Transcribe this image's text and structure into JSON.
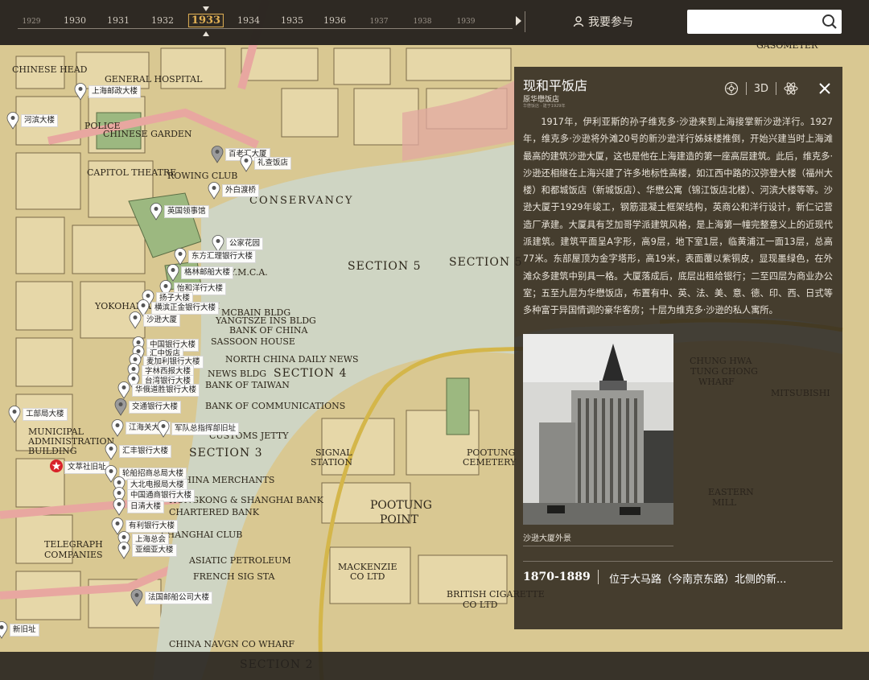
{
  "timeline": {
    "years": [
      {
        "label": "1929",
        "size": "sm"
      },
      {
        "label": "1930",
        "size": "md"
      },
      {
        "label": "1931",
        "size": "md"
      },
      {
        "label": "1932",
        "size": "md"
      },
      {
        "label": "1933",
        "size": "active"
      },
      {
        "label": "1934",
        "size": "md"
      },
      {
        "label": "1935",
        "size": "md"
      },
      {
        "label": "1936",
        "size": "md"
      },
      {
        "label": "1937",
        "size": "sm"
      },
      {
        "label": "1938",
        "size": "sm"
      },
      {
        "label": "1939",
        "size": "sm"
      }
    ],
    "selected": "1933",
    "play_icon": "play-icon"
  },
  "header": {
    "participate_label": "我要参与",
    "participate_icon": "user-icon",
    "search_placeholder": "",
    "search_icon": "search-icon"
  },
  "map": {
    "labels": [
      "CHINESE HEAD",
      "GENERAL HOSPITAL",
      "POLICE",
      "CHINESE GARDEN",
      "CAPITOL THEATRE",
      "ROWING CLUB",
      "CONSERVANCY",
      "SECTION 5",
      "SECTION 4",
      "SECTION 3",
      "SECTION 2",
      "YOKOHAMA SPECIE BANK",
      "BANK OF CHINA",
      "SASSOON HOUSE",
      "NEWS BLDG",
      "BANK OF TAIWAN",
      "BANK OF COMMUNICATIONS",
      "CUSTOMS JETTY",
      "CHINA MERCHANTS",
      "POOTUNG POINT",
      "MACKENZIE CO LTD",
      "BRITISH CIGARETTE CO LTD",
      "FRENCH SIG STA",
      "CHUNG HWA TUNG CHONG WHARF",
      "MITSUBISHI",
      "EASTERN MILL",
      "GASOMETER",
      "MUNICIPAL ADMINISTRATION BUILDING",
      "TELEGRAPH COMPANIES",
      "CHINA NAVGN CO WHARF",
      "HONGKONG & SHANGHAI BANK",
      "CHARTERED BANK",
      "ASIATIC PETROLEUM",
      "SHANGHAI CLUB",
      "NAVY Y.M.C.A.",
      "YANGTSZE INS BLDG",
      "MCBAIN BLDG",
      "NORTH CHINA DAILY NEWS",
      "POOTUNG CEMETERY",
      "SIGNAL STATION"
    ],
    "pins": [
      {
        "label": "上海邮政大楼",
        "color": "#ffffff",
        "type": "pin"
      },
      {
        "label": "河滨大楼",
        "color": "#ffffff",
        "type": "pin"
      },
      {
        "label": "百老汇大厦",
        "color": "#9b9b9b",
        "type": "pin"
      },
      {
        "label": "礼查饭店",
        "color": "#ffffff",
        "type": "pin"
      },
      {
        "label": "外白渡桥",
        "color": "#ffffff",
        "type": "pin"
      },
      {
        "label": "英国领事馆",
        "color": "#ffffff",
        "type": "pin"
      },
      {
        "label": "公家花园",
        "color": "#ffffff",
        "type": "pin"
      },
      {
        "label": "东方汇理银行大楼",
        "color": "#ffffff",
        "type": "pin"
      },
      {
        "label": "格林邮船大楼",
        "color": "#ffffff",
        "type": "pin"
      },
      {
        "label": "怡和洋行大楼",
        "color": "#ffffff",
        "type": "pin"
      },
      {
        "label": "扬子大楼",
        "color": "#ffffff",
        "type": "pin"
      },
      {
        "label": "横滨正金银行大楼",
        "color": "#ffffff",
        "type": "pin"
      },
      {
        "label": "沙逊大厦",
        "color": "#ffffff",
        "type": "pin"
      },
      {
        "label": "中国银行大楼",
        "color": "#ffffff",
        "type": "pin"
      },
      {
        "label": "汇中饭店",
        "color": "#ffffff",
        "type": "pin"
      },
      {
        "label": "麦加利银行大楼",
        "color": "#ffffff",
        "type": "pin"
      },
      {
        "label": "字林西报大楼",
        "color": "#ffffff",
        "type": "pin"
      },
      {
        "label": "台湾银行大楼",
        "color": "#ffffff",
        "type": "pin"
      },
      {
        "label": "华俄道胜银行大楼",
        "color": "#ffffff",
        "type": "pin"
      },
      {
        "label": "交通银行大楼",
        "color": "#9b9b9b",
        "type": "pin"
      },
      {
        "label": "工部局大楼",
        "color": "#ffffff",
        "type": "pin"
      },
      {
        "label": "江海关大楼",
        "color": "#ffffff",
        "type": "pin"
      },
      {
        "label": "军队总指挥部旧址",
        "color": "#ffffff",
        "type": "pin"
      },
      {
        "label": "汇丰银行大楼",
        "color": "#ffffff",
        "type": "pin"
      },
      {
        "label": "文萃社旧址",
        "color": "#d8222a",
        "type": "star"
      },
      {
        "label": "轮船招商总局大楼",
        "color": "#ffffff",
        "type": "pin"
      },
      {
        "label": "大北电报局大楼",
        "color": "#ffffff",
        "type": "pin"
      },
      {
        "label": "中国通商银行大楼",
        "color": "#ffffff",
        "type": "pin"
      },
      {
        "label": "日清大楼",
        "color": "#ffffff",
        "type": "pin"
      },
      {
        "label": "有利银行大楼",
        "color": "#ffffff",
        "type": "pin"
      },
      {
        "label": "上海总会",
        "color": "#ffffff",
        "type": "pin"
      },
      {
        "label": "亚细亚大楼",
        "color": "#ffffff",
        "type": "pin"
      },
      {
        "label": "法国邮船公司大楼",
        "color": "#9b9b9b",
        "type": "pin"
      },
      {
        "label": "新旧址",
        "color": "#ffffff",
        "type": "pin"
      }
    ]
  },
  "panel": {
    "title": "现和平饭店",
    "subtitle": "原华懋饭店",
    "subtitle_small": "华懋饭店 · 建于1929年",
    "tools": [
      "panorama-icon",
      "3D",
      "atom-icon"
    ],
    "close_icon": "close-icon",
    "body": "1917年，伊利亚斯的孙子维克多·沙逊来到上海接掌新沙逊洋行。1927年，维克多·沙逊将外滩20号的新沙逊洋行姊妹楼推倒，开始兴建当时上海滩最高的建筑沙逊大厦，这也是他在上海建造的第一座高层建筑。此后，维克多·沙逊还相继在上海兴建了许多地标性高楼，如江西中路的汉弥登大楼（福州大楼）和都城饭店（新城饭店）、华懋公寓（锦江饭店北楼）、河滨大楼等等。沙逊大厦于1929年竣工，钢筋混凝土框架结构，英商公和洋行设计，新仁记营造厂承建。大厦具有芝加哥学派建筑风格，是上海第一幢完整意义上的近现代派建筑。建筑平面呈A字形，高9层，地下室1层，临黄浦江一面13层，总高77米。东部屋顶为金字塔形，高19米，表面覆以紫铜皮，显现墨绿色，在外滩众多建筑中别具一格。大厦落成后，底层出租给银行；二至四层为商业办公室；五至九层为华懋饭店，布置有中、英、法、美、意、德、印、西、日式等多种富于异国情调的豪华客房；十层为维克多·沙逊的私人寓所。",
    "photo_caption": "沙逊大厦外景",
    "event_years": "1870-1889",
    "event_text": "位于大马路（今南京东路）北侧的新..."
  },
  "colors": {
    "accent": "#e3b255",
    "river": "#cfd5c3",
    "map_paper": "#e7d8ac",
    "road_pink": "#e8a7a0",
    "star": "#d8222a"
  }
}
